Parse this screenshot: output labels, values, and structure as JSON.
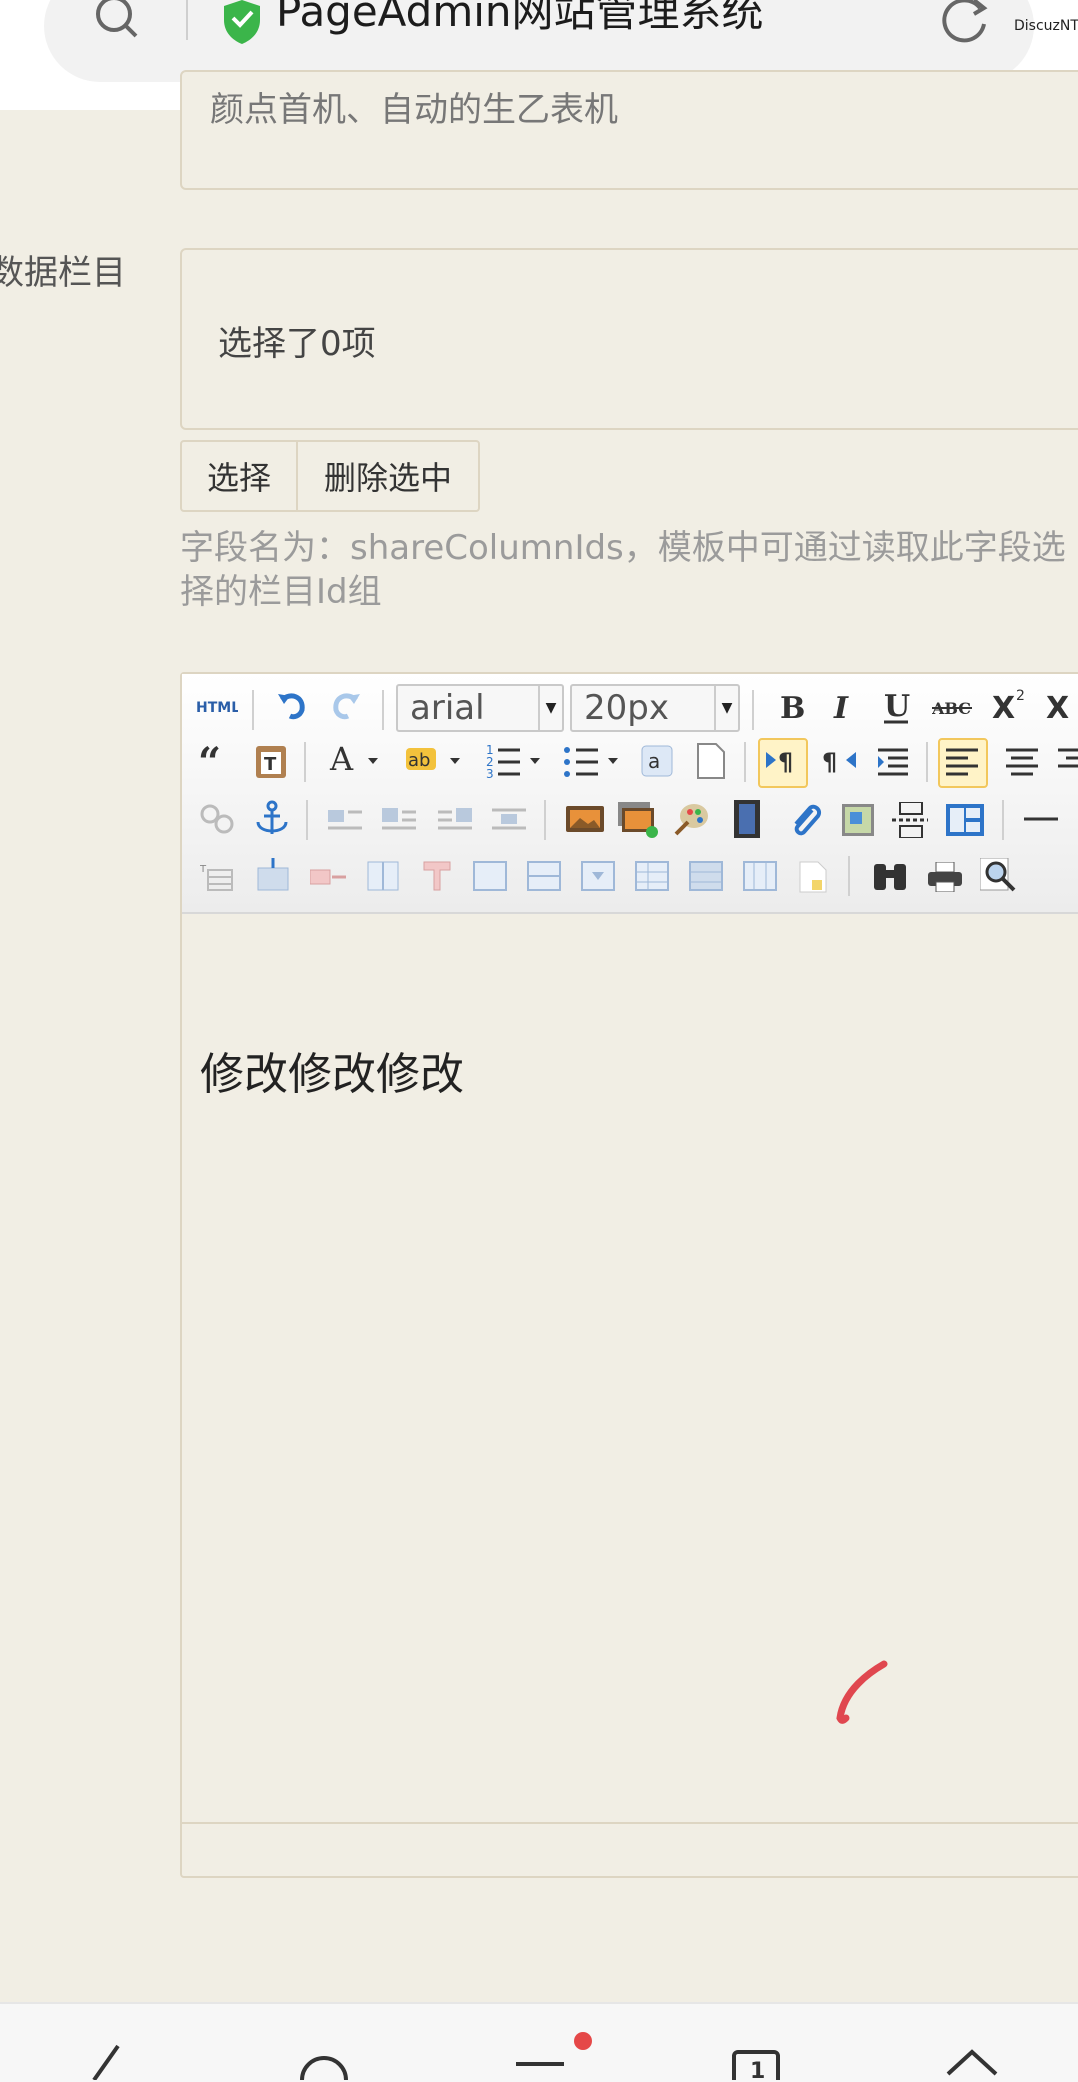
{
  "browser": {
    "title": "PageAdmin网站管理系统",
    "extension_label": "DiscuzNT"
  },
  "form": {
    "top_field_text": "颜点首机、自动的生乙表机",
    "column_field": {
      "label": "数据栏目",
      "selected_count_text": "选择了0项",
      "select_button": "选择",
      "delete_button": "删除选中",
      "help_text": "字段名为：shareColumnIds，模板中可通过读取此字段选择的栏目Id组"
    }
  },
  "editor": {
    "font_family": "arial",
    "font_size": "20px",
    "content_text": "修改修改修改"
  },
  "colors": {
    "page_bg": "#f1eee4",
    "border": "#ddd5c2",
    "secure_green": "#3bb54a",
    "notification_red": "#e54848"
  }
}
